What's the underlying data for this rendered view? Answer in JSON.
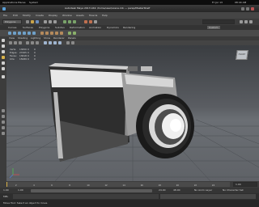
{
  "os_bar": {
    "left_items": [
      "Applications",
      "Places",
      "System"
    ],
    "right_items": [
      "Fri Jul 13",
      "08:44 AM"
    ]
  },
  "title_bar": {
    "title": "Autodesk Maya 2013 x64: /home/user/scene.mb --- persp/MasterShelf"
  },
  "menu_bar": {
    "items": [
      "File",
      "Edit",
      "Modify",
      "Create",
      "Display",
      "Window",
      "Assets",
      "Muscle",
      "Help"
    ]
  },
  "status_line": {
    "menu_set": "Polygons"
  },
  "shelf": {
    "tabs": [
      "Curves",
      "Surfaces",
      "Polygons",
      "Subdivs",
      "Deformation",
      "Animation",
      "Dynamics",
      "Rendering",
      "Custom"
    ]
  },
  "panel_menu": {
    "items": [
      "View",
      "Shading",
      "Lighting",
      "Show",
      "Renderer",
      "Panels"
    ]
  },
  "hud": {
    "rows": [
      {
        "label": "Verts:",
        "value": "13650",
        "a": "0",
        "b": "0"
      },
      {
        "label": "Edges:",
        "value": "27265",
        "a": "0",
        "b": "0"
      },
      {
        "label": "Faces:",
        "value": "13618",
        "a": "0",
        "b": "0"
      },
      {
        "label": "UVs:",
        "value": "15089",
        "a": "0",
        "b": "0"
      }
    ]
  },
  "viewcube": {
    "label": "FRONT"
  },
  "time_slider": {
    "ticks": [
      "2",
      "4",
      "6",
      "8",
      "10",
      "12",
      "14",
      "16",
      "18",
      "20",
      "22",
      "24"
    ],
    "current_frame": "1.00"
  },
  "range": {
    "start": "1.00",
    "end": "24.00",
    "start2": "1.00",
    "end2": "48.00",
    "anim_layer": "No Anim Layer",
    "char_set": "No Character Set"
  },
  "command_line": {
    "label": "MEL"
  },
  "help_line": {
    "text": "Move Tool: Select an object to move."
  },
  "colors": {
    "accent": "#d8b24a",
    "viewport_top": "#3a3d41",
    "viewport_bottom": "#6b6f74"
  }
}
